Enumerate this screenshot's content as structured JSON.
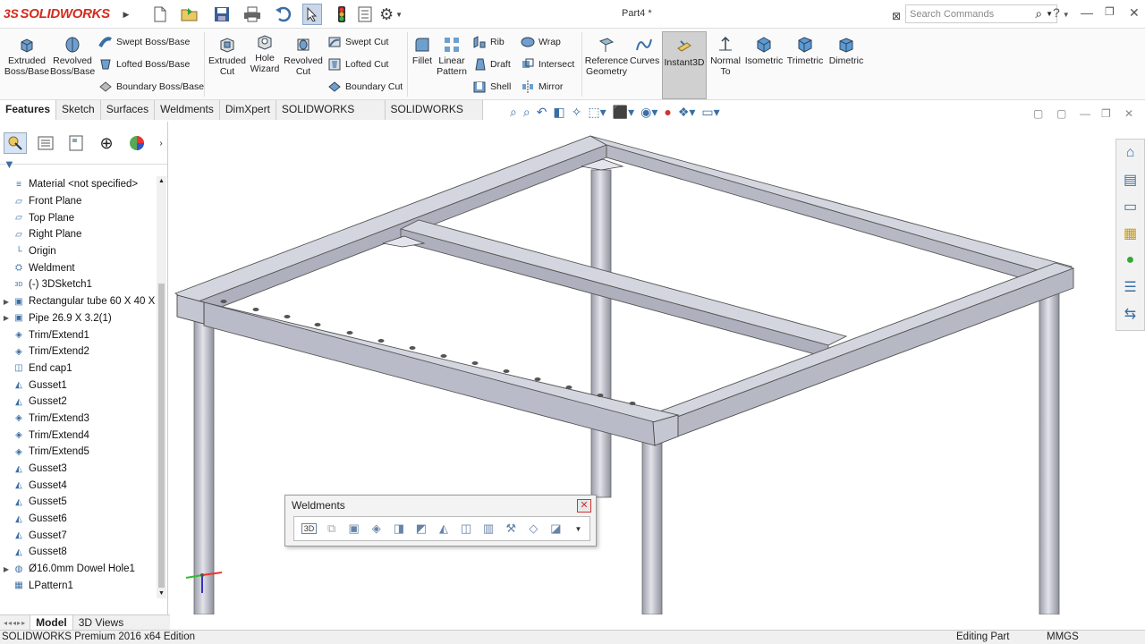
{
  "app": {
    "logo_ds": "3S",
    "logo_text": "SOLIDWORKS",
    "doc_title": "Part4 *",
    "search_placeholder": "Search Commands"
  },
  "ribbon": {
    "extruded_boss": "Extruded\nBoss/Base",
    "revolved_boss": "Revolved\nBoss/Base",
    "swept_boss": "Swept Boss/Base",
    "lofted_boss": "Lofted Boss/Base",
    "boundary_boss": "Boundary Boss/Base",
    "extruded_cut": "Extruded\nCut",
    "hole_wizard": "Hole\nWizard",
    "revolved_cut": "Revolved\nCut",
    "swept_cut": "Swept Cut",
    "lofted_cut": "Lofted Cut",
    "boundary_cut": "Boundary Cut",
    "fillet": "Fillet",
    "linear_pattern": "Linear\nPattern",
    "rib": "Rib",
    "draft": "Draft",
    "shell": "Shell",
    "wrap": "Wrap",
    "intersect": "Intersect",
    "mirror": "Mirror",
    "reference_geometry": "Reference\nGeometry",
    "curves": "Curves",
    "instant3d": "Instant3D",
    "normal_to": "Normal\nTo",
    "isometric": "Isometric",
    "trimetric": "Trimetric",
    "dimetric": "Dimetric"
  },
  "tabs": [
    "Features",
    "Sketch",
    "Surfaces",
    "Weldments",
    "DimXpert",
    "SOLIDWORKS Add-Ins",
    "SOLIDWORKS MBD"
  ],
  "tree": [
    {
      "label": "Material <not specified>",
      "icon": "material-icon",
      "expand": false
    },
    {
      "label": "Front Plane",
      "icon": "plane-icon",
      "expand": false
    },
    {
      "label": "Top Plane",
      "icon": "plane-icon",
      "expand": false
    },
    {
      "label": "Right Plane",
      "icon": "plane-icon",
      "expand": false
    },
    {
      "label": "Origin",
      "icon": "origin-icon",
      "expand": false
    },
    {
      "label": "Weldment",
      "icon": "weldment-icon",
      "expand": false
    },
    {
      "label": "(-) 3DSketch1",
      "icon": "sketch3d-icon",
      "expand": false
    },
    {
      "label": "Rectangular tube 60 X 40 X",
      "icon": "structural-member-icon",
      "expand": true
    },
    {
      "label": "Pipe 26.9 X 3.2(1)",
      "icon": "structural-member-icon",
      "expand": true
    },
    {
      "label": "Trim/Extend1",
      "icon": "trim-icon",
      "expand": false
    },
    {
      "label": "Trim/Extend2",
      "icon": "trim-icon",
      "expand": false
    },
    {
      "label": "End cap1",
      "icon": "end-cap-icon",
      "expand": false
    },
    {
      "label": "Gusset1",
      "icon": "gusset-icon",
      "expand": false
    },
    {
      "label": "Gusset2",
      "icon": "gusset-icon",
      "expand": false
    },
    {
      "label": "Trim/Extend3",
      "icon": "trim-icon",
      "expand": false
    },
    {
      "label": "Trim/Extend4",
      "icon": "trim-icon",
      "expand": false
    },
    {
      "label": "Trim/Extend5",
      "icon": "trim-icon",
      "expand": false
    },
    {
      "label": "Gusset3",
      "icon": "gusset-icon",
      "expand": false
    },
    {
      "label": "Gusset4",
      "icon": "gusset-icon",
      "expand": false
    },
    {
      "label": "Gusset5",
      "icon": "gusset-icon",
      "expand": false
    },
    {
      "label": "Gusset6",
      "icon": "gusset-icon",
      "expand": false
    },
    {
      "label": "Gusset7",
      "icon": "gusset-icon",
      "expand": false
    },
    {
      "label": "Gusset8",
      "icon": "gusset-icon",
      "expand": false
    },
    {
      "label": "Ø16.0mm Dowel Hole1",
      "icon": "hole-icon",
      "expand": true
    },
    {
      "label": "LPattern1",
      "icon": "pattern-icon",
      "expand": false
    }
  ],
  "bottom_tabs": {
    "model": "Model",
    "views3d": "3D Views"
  },
  "status": {
    "edition": "SOLIDWORKS Premium 2016 x64 Edition",
    "editing": "Editing Part",
    "units": "MMGS"
  },
  "weldments_toolbar": {
    "title": "Weldments",
    "sketch3d_label": "3D"
  },
  "colors": {
    "steel_face": "#b9bbc9",
    "steel_top": "#d3d5df",
    "steel_dark": "#8c8e9d",
    "pipe": "#c5c7cf",
    "accent": "#3a6ea5"
  }
}
